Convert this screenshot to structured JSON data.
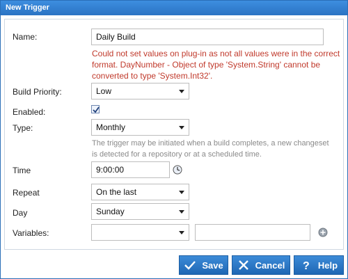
{
  "window": {
    "title": "New Trigger"
  },
  "form": {
    "name_label": "Name:",
    "name_value": "Daily Build",
    "error_text": "Could not set values on plug-in as not all values were in the correct format. DayNumber - Object of type 'System.String' cannot be converted to type 'System.Int32'.",
    "priority_label": "Build Priority:",
    "priority_value": "Low",
    "enabled_label": "Enabled:",
    "enabled_checked": true,
    "type_label": "Type:",
    "type_value": "Monthly",
    "type_help": "The trigger may be initiated when a build completes, a new changeset is detected for a repository or at a scheduled time.",
    "time_label": "Time",
    "time_value": "9:00:00",
    "repeat_label": "Repeat",
    "repeat_value": "On the last",
    "day_label": "Day",
    "day_value": "Sunday",
    "variables_label": "Variables:",
    "variables_select_value": "",
    "variables_text_value": ""
  },
  "buttons": {
    "save": "Save",
    "cancel": "Cancel",
    "help": "Help"
  },
  "icons": {
    "clock": "clock-icon",
    "add": "add-circle-icon",
    "check": "check-icon",
    "x": "x-icon",
    "question": "question-icon"
  },
  "colors": {
    "accent": "#2a73c3",
    "error": "#c0392b",
    "help_text": "#8a8a8a"
  }
}
